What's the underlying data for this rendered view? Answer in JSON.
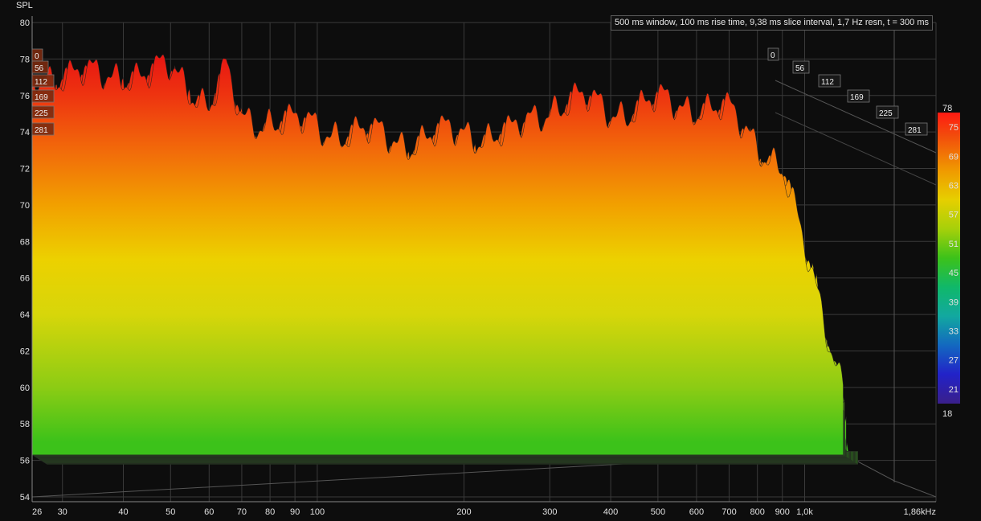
{
  "chart_data": {
    "type": "waterfall",
    "title": "",
    "ylabel": "SPL",
    "info": "500 ms window, 100 ms rise time, 9,38 ms slice interval, 1,7 Hz resn, t = 300 ms",
    "y_ticks": [
      "54",
      "56",
      "58",
      "60",
      "62",
      "64",
      "66",
      "68",
      "70",
      "72",
      "74",
      "76",
      "78",
      "80"
    ],
    "ylim": [
      54,
      80
    ],
    "x_ticks": [
      "26",
      "30",
      "40",
      "50",
      "60",
      "70",
      "80",
      "90",
      "100",
      "200",
      "300",
      "400",
      "500",
      "600",
      "700",
      "800",
      "900",
      "1,0k",
      "1,86kHz"
    ],
    "x_tick_values": [
      26,
      30,
      40,
      50,
      60,
      70,
      80,
      90,
      100,
      200,
      300,
      400,
      500,
      600,
      700,
      800,
      900,
      1000,
      1860
    ],
    "x_scale": "log",
    "xlim": [
      26,
      1860
    ],
    "time_slices_ms": [
      "0",
      "56",
      "112",
      "169",
      "225",
      "281"
    ],
    "colorbar": {
      "ticks": [
        "78",
        "75",
        "69",
        "63",
        "57",
        "51",
        "45",
        "39",
        "33",
        "27",
        "21",
        "18"
      ],
      "range": [
        18,
        78
      ]
    },
    "envelope": {
      "freq_hz": [
        26,
        30,
        35,
        40,
        45,
        50,
        55,
        60,
        65,
        70,
        80,
        90,
        100,
        120,
        150,
        200,
        250,
        300,
        350,
        400,
        450,
        500,
        600,
        700,
        800,
        900,
        1000
      ],
      "peak_spl_db": [
        77.0,
        77.2,
        77.0,
        77.3,
        77.0,
        77.5,
        76.5,
        75.5,
        77.3,
        74.5,
        74.8,
        74.5,
        74.2,
        74.0,
        73.5,
        74.0,
        73.8,
        75.5,
        75.7,
        75.2,
        75.3,
        75.6,
        75.5,
        75.0,
        73.5,
        72.0,
        67.5
      ]
    },
    "grid": true
  }
}
